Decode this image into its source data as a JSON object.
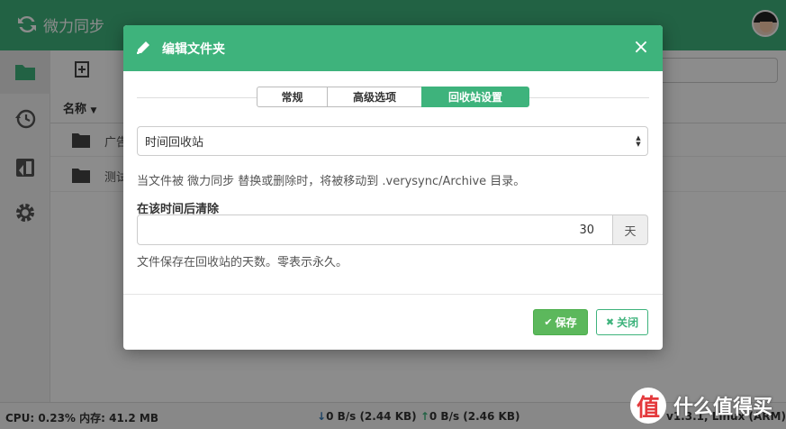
{
  "app": {
    "name": "微力同步",
    "column_header": "名称",
    "rows": [
      {
        "name": "广告"
      },
      {
        "name": "测试"
      }
    ]
  },
  "status": {
    "cpu": "CPU: 0.23% 内存: 41.2 MB",
    "down": "0 B/s (2.44 KB)",
    "up": "0 B/s (2.46 KB)",
    "version": "v1.3.1, Linux (ARM)"
  },
  "modal": {
    "title": "编辑文件夹",
    "close_glyph": "×",
    "tabs": [
      {
        "label": "常规",
        "active": false
      },
      {
        "label": "高级选项",
        "active": false
      },
      {
        "label": "回收站设置",
        "active": true
      }
    ],
    "versioning_select": {
      "value": "时间回收站"
    },
    "help_text": "当文件被 微力同步 替换或删除时，将被移动到 .verysync/Archive 目录。",
    "cleanout_label": "在该时间后清除",
    "cleanout_value": "30",
    "cleanout_unit": "天",
    "cleanout_help": "文件保存在回收站的天数。零表示永久。",
    "save_label": "保存",
    "close_label": "关闭"
  },
  "watermark": {
    "badge": "值",
    "text": "什么值得买"
  },
  "colors": {
    "brand_green": "#3eb37c",
    "save_green": "#5cb85c",
    "download_blue": "#337ab7"
  },
  "icons": [
    "sync-icon",
    "folder-icon",
    "history-icon",
    "devices-icon",
    "gear-icon",
    "add-folder-icon",
    "pencil-icon",
    "close-icon",
    "check-icon",
    "times-icon",
    "arrow-down-icon",
    "arrow-up-icon"
  ]
}
